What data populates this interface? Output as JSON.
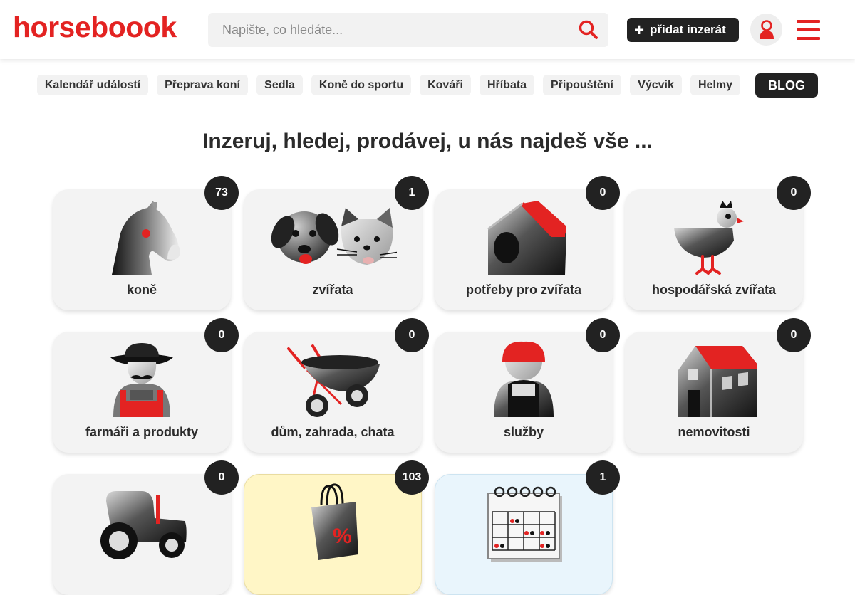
{
  "header": {
    "logo": "horseboook",
    "search_placeholder": "Napište, co hledáte...",
    "add_label": "přidat inzerát",
    "accent": "#e32322"
  },
  "pills": [
    "Kalendář událostí",
    "Přeprava koní",
    "Sedla",
    "Koně do sportu",
    "Kováři",
    "Hříbata",
    "Připouštění",
    "Výcvik",
    "Helmy"
  ],
  "blog_label": "BLOG",
  "headline": "Inzeruj, hledej, prodávej, u nás najdeš vše ...",
  "cards": [
    {
      "label": "koně",
      "count": "73",
      "icon": "horse-icon"
    },
    {
      "label": "zvířata",
      "count": "1",
      "icon": "dog-cat-icon"
    },
    {
      "label": "potřeby pro zvířata",
      "count": "0",
      "icon": "kennel-icon"
    },
    {
      "label": "hospodářská zvířata",
      "count": "0",
      "icon": "hen-icon"
    },
    {
      "label": "farmáři a produkty",
      "count": "0",
      "icon": "farmer-icon"
    },
    {
      "label": "dům, zahrada, chata",
      "count": "0",
      "icon": "wheelbarrow-icon"
    },
    {
      "label": "služby",
      "count": "0",
      "icon": "worker-icon"
    },
    {
      "label": "nemovitosti",
      "count": "0",
      "icon": "house-icon"
    },
    {
      "label": "",
      "count": "0",
      "icon": "tractor-icon"
    },
    {
      "label": "",
      "count": "103",
      "icon": "shopping-bag-icon"
    },
    {
      "label": "",
      "count": "1",
      "icon": "calendar-icon"
    }
  ]
}
